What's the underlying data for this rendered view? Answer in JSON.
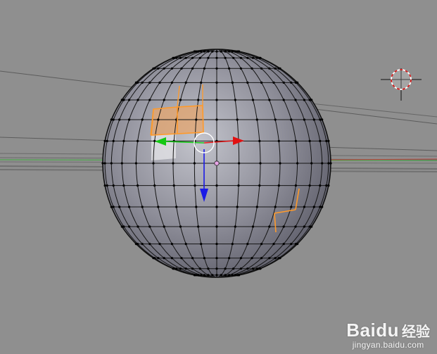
{
  "viewport": {
    "background_color": "#8f8f8f",
    "mode": "edit-mode",
    "object": "uv-sphere",
    "colors": {
      "sphere_face": "#85858f",
      "wire": "#111111",
      "vertex": "#000000",
      "selected_edge": "#ff9a2a",
      "selected_face": "#e6a66e",
      "axis_x": "#e11111",
      "axis_y": "#14c814",
      "axis_z": "#1a1ae6",
      "cursor_red": "#d11a1a",
      "grid_line": "#5c5c5c",
      "x_axis_line": "#c04040",
      "y_axis_line": "#3faa3f"
    }
  },
  "icons": {
    "cursor": "3d-cursor-icon",
    "manipulator": "translate-manipulator-icon",
    "pivot": "pivot-point-icon"
  },
  "watermark": {
    "brand": "Baidu",
    "cn": "经验",
    "url": "jingyan.baidu.com"
  }
}
